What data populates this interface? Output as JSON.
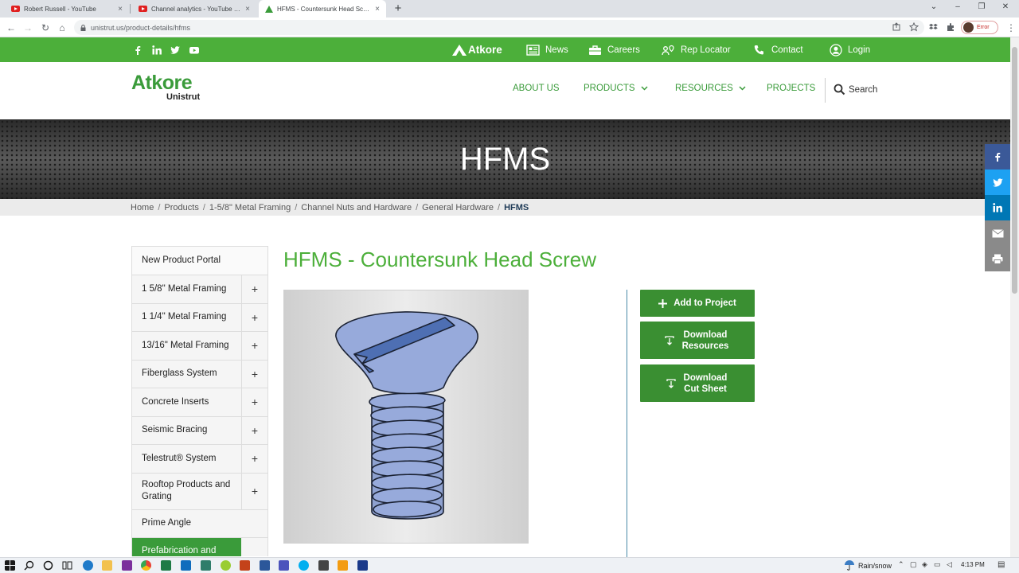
{
  "browser": {
    "tabs": [
      {
        "title": "Robert Russell - YouTube",
        "close": "×",
        "favicon": "youtube-icon"
      },
      {
        "title": "Channel analytics - YouTube Studio",
        "close": "×",
        "favicon": "youtube-icon"
      },
      {
        "title": "HFMS - Countersunk Head Screw",
        "close": "×",
        "favicon": "atkore-icon"
      }
    ],
    "new_tab": "+",
    "url": "unistrut.us/product-details/hfms",
    "profile_status": "Error"
  },
  "utility_bar": {
    "brand": "Atkore",
    "links": [
      {
        "label": "News",
        "icon": "newspaper-icon"
      },
      {
        "label": "Careers",
        "icon": "briefcase-icon"
      },
      {
        "label": "Rep Locator",
        "icon": "rep-locator-icon"
      },
      {
        "label": "Contact",
        "icon": "phone-icon"
      },
      {
        "label": "Login",
        "icon": "user-icon"
      }
    ],
    "social": [
      "facebook-icon",
      "linkedin-icon",
      "twitter-icon",
      "youtube-icon"
    ]
  },
  "nav": {
    "logo_main": "Atkore",
    "logo_sub": "Unistrut",
    "items": [
      {
        "label": "ABOUT US"
      },
      {
        "label": "PRODUCTS"
      },
      {
        "label": "RESOURCES"
      },
      {
        "label": "PROJECTS"
      }
    ],
    "search_label": "Search"
  },
  "banner": {
    "title": "HFMS"
  },
  "breadcrumb": {
    "items": [
      "Home",
      "Products",
      "1-5/8\" Metal Framing",
      "Channel Nuts and Hardware",
      "General Hardware"
    ],
    "separator": "/",
    "current": "HFMS"
  },
  "sidebar": {
    "expand_symbol": "+",
    "items": [
      {
        "label": "New Product Portal"
      },
      {
        "label": "1 5/8\" Metal Framing"
      },
      {
        "label": "1 1/4\" Metal Framing"
      },
      {
        "label": "13/16\" Metal Framing"
      },
      {
        "label": "Fiberglass System"
      },
      {
        "label": "Concrete Inserts"
      },
      {
        "label": "Seismic Bracing"
      },
      {
        "label": "Telestrut® System"
      },
      {
        "label": "Rooftop Products and Grating"
      },
      {
        "label": "Prime Angle"
      },
      {
        "label": "Prefabrication and"
      }
    ]
  },
  "product": {
    "title": "HFMS - Countersunk Head Screw",
    "image_alt": "countersunk-head-screw-illustration",
    "actions": [
      {
        "label": "Add to Project",
        "icon": "plus-icon"
      },
      {
        "label": "Download Resources",
        "icon": "download-icon"
      },
      {
        "label": "Download Cut Sheet",
        "icon": "download-icon"
      }
    ]
  },
  "share_bar": [
    {
      "icon": "facebook-icon",
      "color": "#3b5998"
    },
    {
      "icon": "twitter-icon",
      "color": "#1da1f2"
    },
    {
      "icon": "linkedin-icon",
      "color": "#0077b5"
    },
    {
      "icon": "email-icon",
      "color": "#8a8a8a"
    },
    {
      "icon": "print-icon",
      "color": "#8a8a8a"
    }
  ],
  "colors": {
    "brand_green": "#4caf3a",
    "button_green": "#3a8f32",
    "breadcrumb_current": "#1f3b57"
  },
  "taskbar": {
    "weather": "Rain/snow",
    "time": "4:13 PM"
  }
}
